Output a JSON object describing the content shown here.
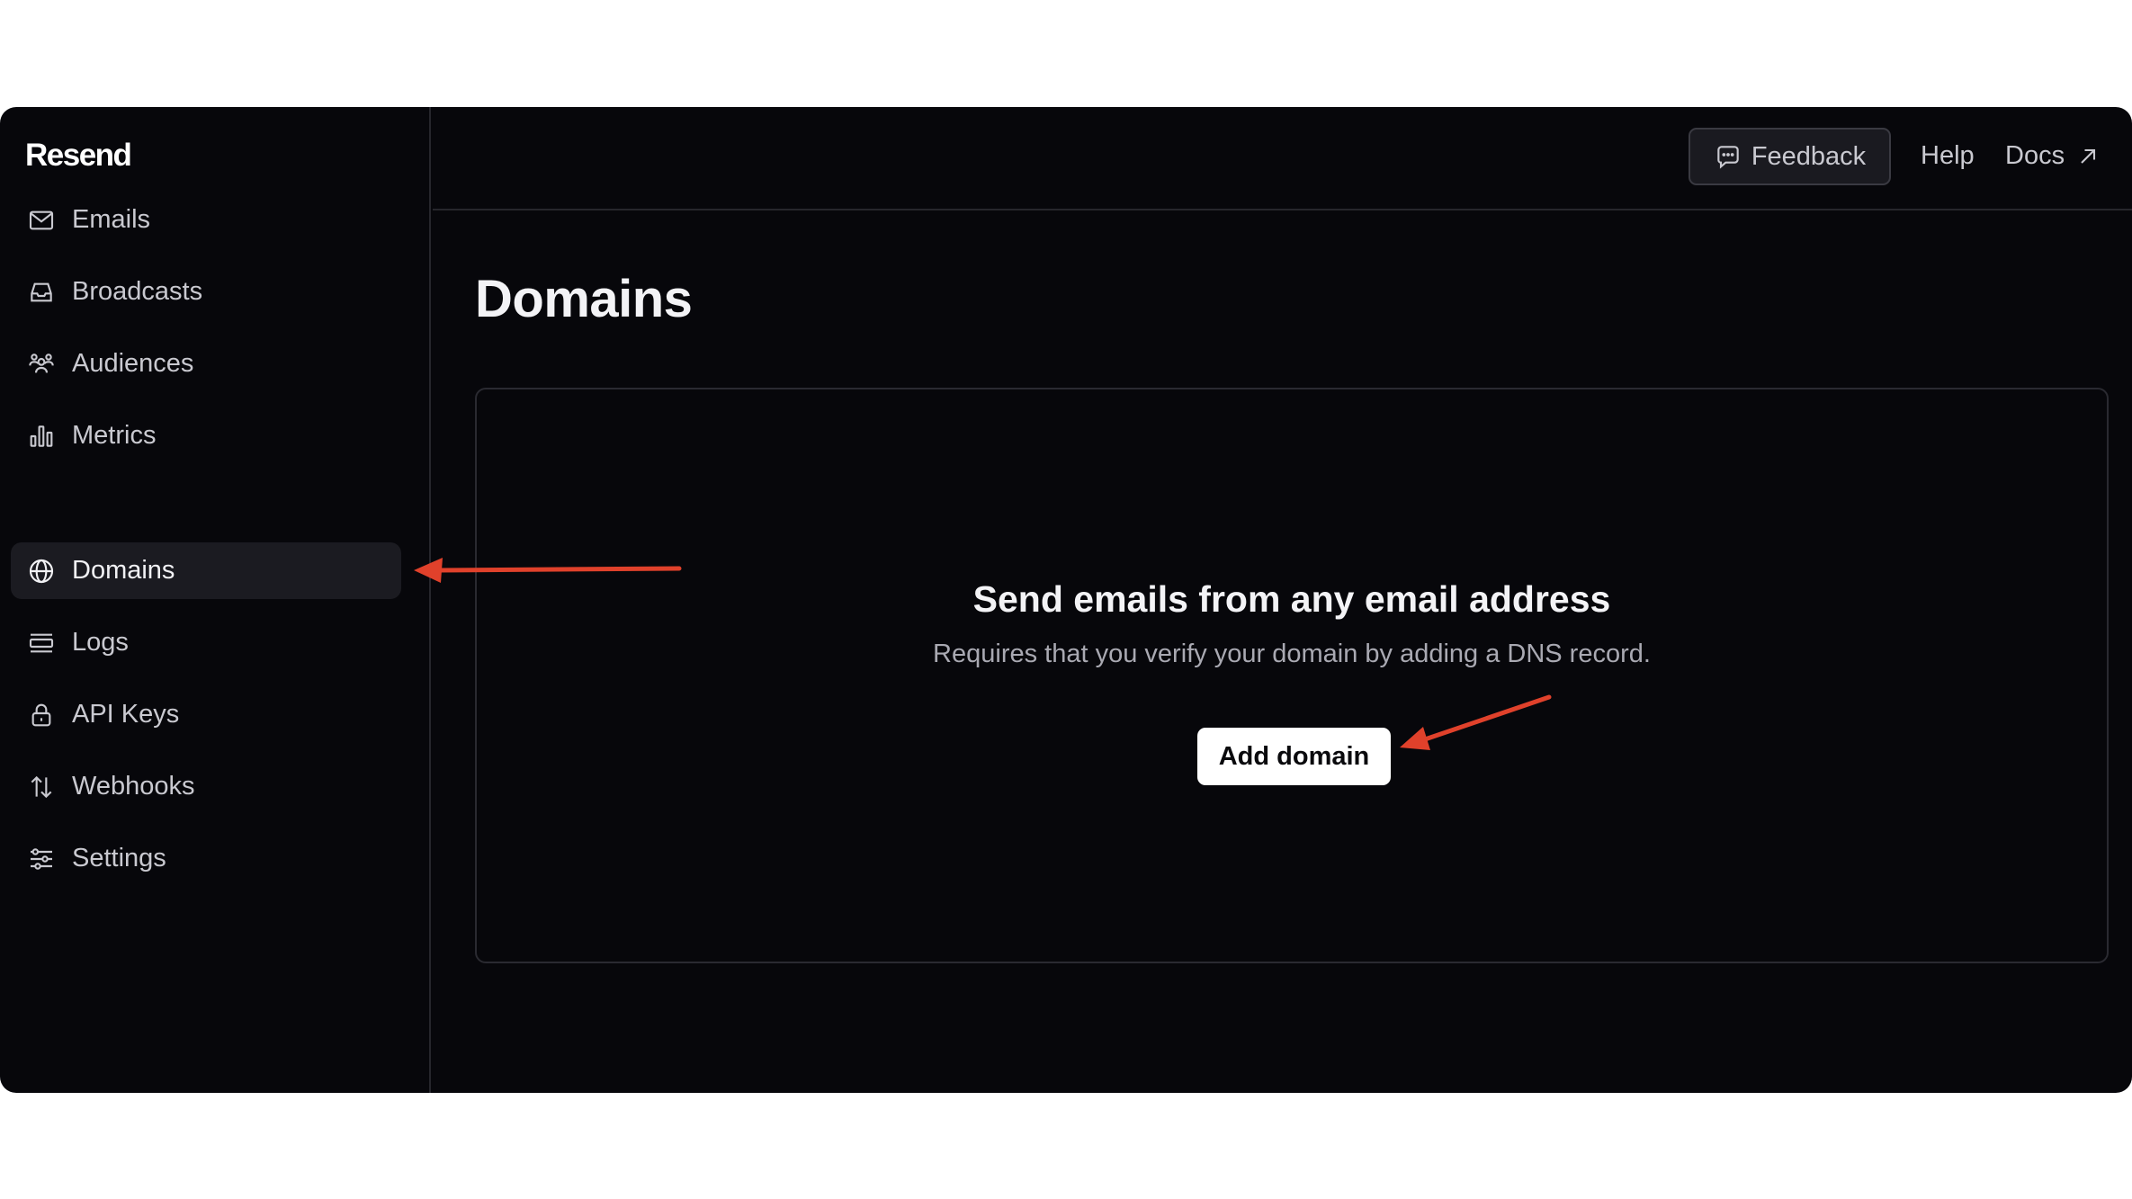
{
  "brand": {
    "logo_text": "Resend"
  },
  "sidebar": {
    "items": [
      {
        "label": "Emails",
        "icon": "mail-icon",
        "active": false
      },
      {
        "label": "Broadcasts",
        "icon": "inbox-icon",
        "active": false
      },
      {
        "label": "Audiences",
        "icon": "users-icon",
        "active": false
      },
      {
        "label": "Metrics",
        "icon": "bar-chart-icon",
        "active": false
      },
      {
        "label": "Domains",
        "icon": "globe-icon",
        "active": true
      },
      {
        "label": "Logs",
        "icon": "list-icon",
        "active": false
      },
      {
        "label": "API Keys",
        "icon": "lock-icon",
        "active": false
      },
      {
        "label": "Webhooks",
        "icon": "arrows-up-down-icon",
        "active": false
      },
      {
        "label": "Settings",
        "icon": "sliders-icon",
        "active": false
      }
    ]
  },
  "header": {
    "feedback_label": "Feedback",
    "help_label": "Help",
    "docs_label": "Docs"
  },
  "main": {
    "title": "Domains",
    "empty_state": {
      "heading": "Send emails from any email address",
      "description": "Requires that you verify your domain by adding a DNS record.",
      "button_label": "Add domain"
    }
  },
  "colors": {
    "background": "#07070b",
    "annotation_arrow": "#e0412b",
    "active_item": "#1b1b21"
  }
}
